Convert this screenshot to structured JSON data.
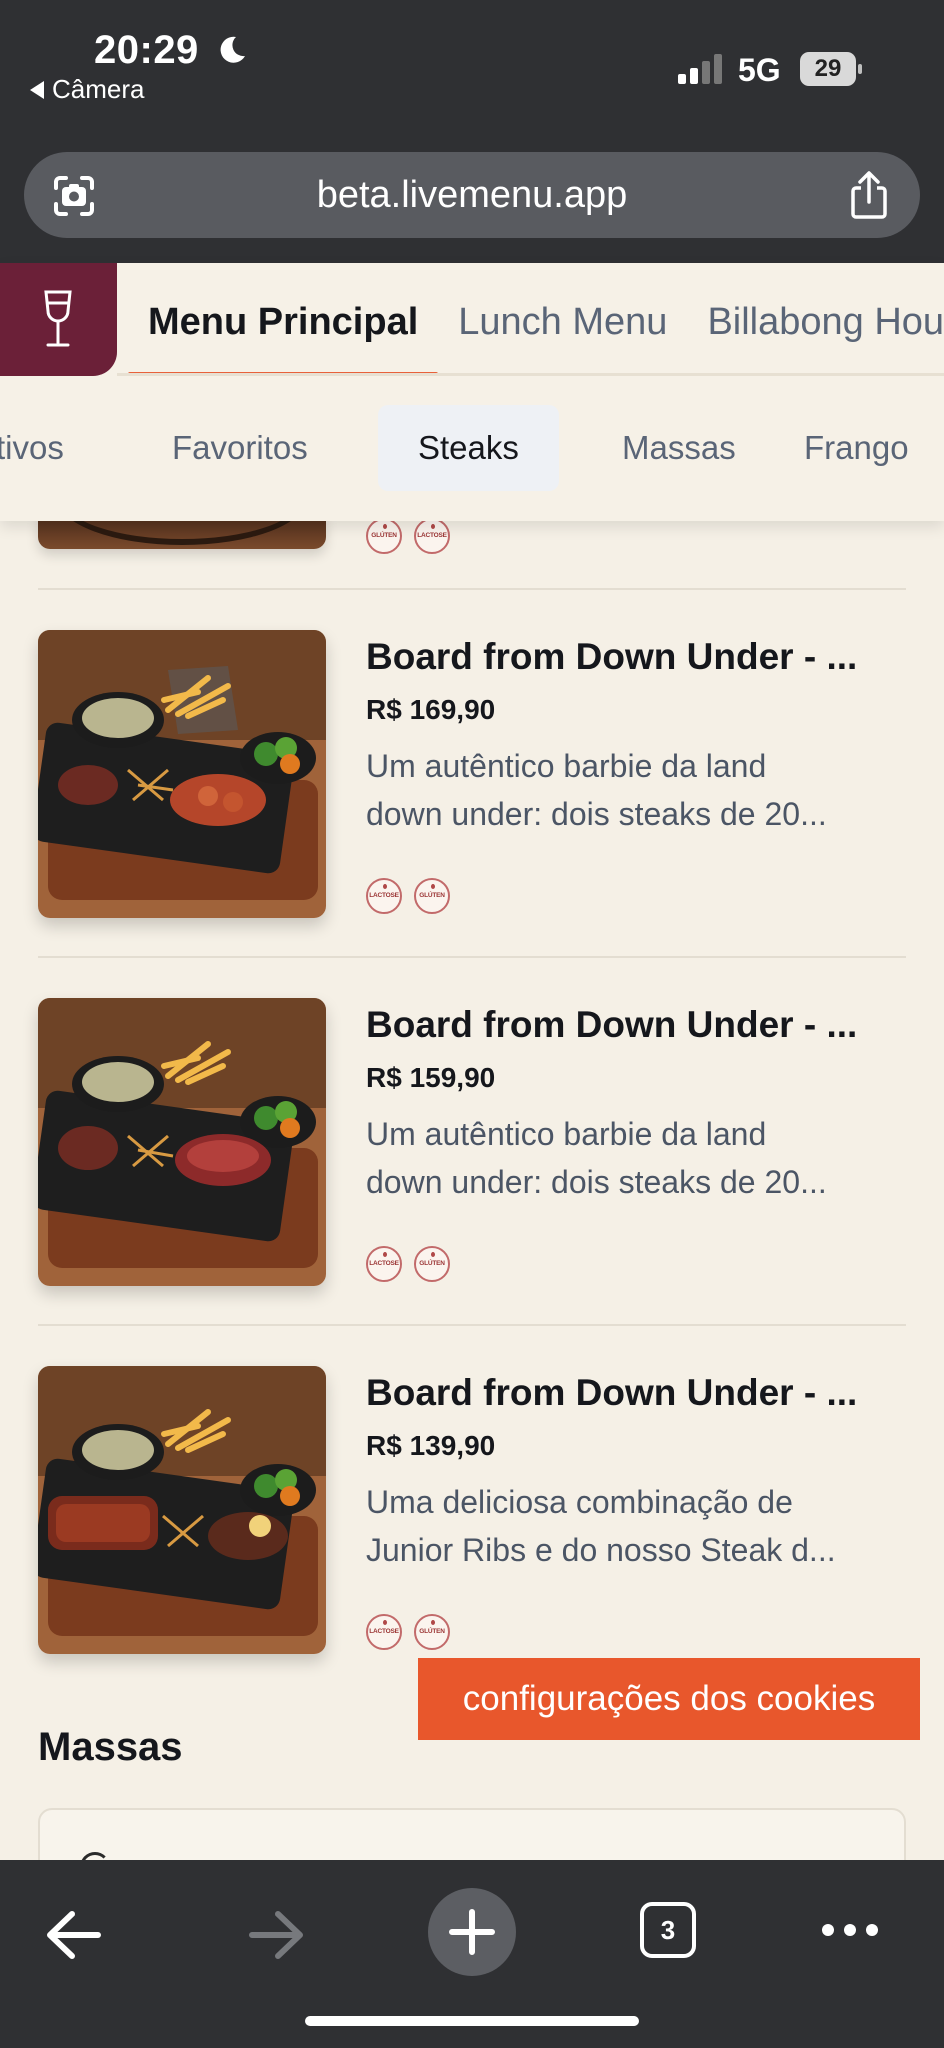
{
  "status_bar": {
    "time": "20:29",
    "back_app": "Câmera",
    "network": "5G",
    "battery": "29"
  },
  "browser": {
    "url": "beta.livemenu.app",
    "tab_count": "3"
  },
  "menu_tabs": [
    {
      "label": "Menu Principal",
      "active": true
    },
    {
      "label": "Lunch Menu",
      "active": false
    },
    {
      "label": "Billabong Hou",
      "active": false
    }
  ],
  "categories": [
    {
      "label": "tivos",
      "active": false
    },
    {
      "label": "Favoritos",
      "active": false
    },
    {
      "label": "Steaks",
      "active": true
    },
    {
      "label": "Massas",
      "active": false
    },
    {
      "label": "Frango",
      "active": false
    }
  ],
  "allergen_labels": {
    "lactose": "LACTOSE",
    "gluten": "GLÚTEN"
  },
  "peek_badges": [
    "GLÚTEN",
    "LACTOSE"
  ],
  "items": [
    {
      "title": "Board from Down Under - ...",
      "price": "R$ 169,90",
      "desc_line1": "Um autêntico barbie da land",
      "desc_line2": "down under: dois steaks de 20...",
      "badges": [
        "LACTOSE",
        "GLÚTEN"
      ]
    },
    {
      "title": "Board from Down Under - ...",
      "price": "R$ 159,90",
      "desc_line1": "Um autêntico barbie da land",
      "desc_line2": "down under: dois steaks de 20...",
      "badges": [
        "LACTOSE",
        "GLÚTEN"
      ]
    },
    {
      "title": "Board from Down Under - ...",
      "price": "R$ 139,90",
      "desc_line1": "Uma deliciosa combinação de",
      "desc_line2": "Junior Ribs e do nosso Steak d...",
      "badges": [
        "LACTOSE",
        "GLÚTEN"
      ]
    }
  ],
  "next_section": {
    "title": "Massas"
  },
  "cookie_button": "configurações dos cookies",
  "colors": {
    "brand_wine": "#6b2038",
    "accent_orange": "#e8572c",
    "page_bg": "#f5f0e6",
    "chrome_dark": "#2f3033"
  }
}
